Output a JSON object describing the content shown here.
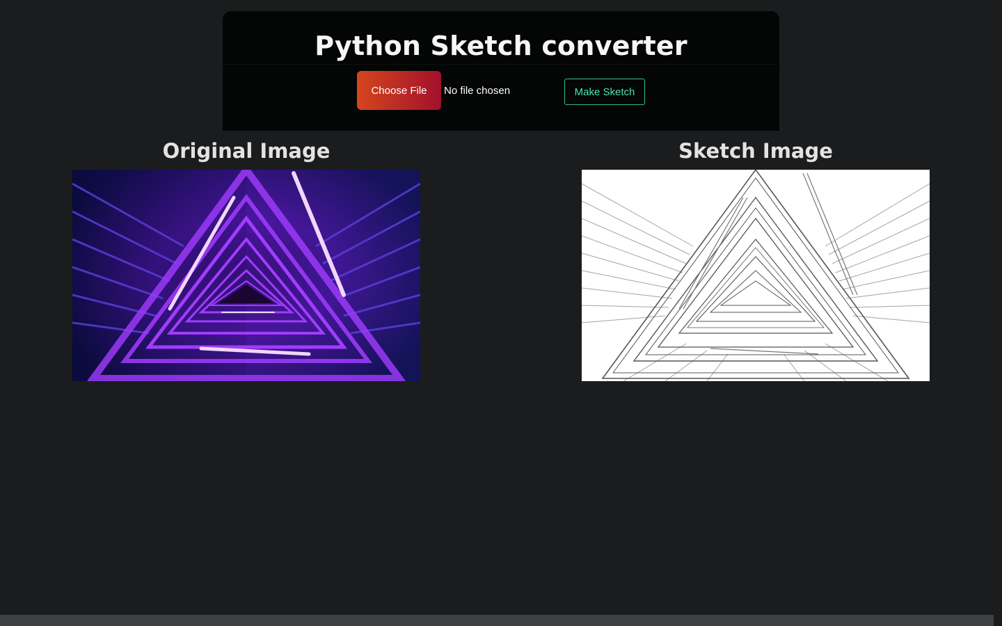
{
  "header": {
    "title": "Python Sketch converter",
    "choose_file_label": "Choose File",
    "file_status": "No file chosen",
    "make_sketch_label": "Make Sketch"
  },
  "panels": {
    "original": {
      "title": "Original Image",
      "image_description_icon": "neon-triangle-stairwell-image"
    },
    "sketch": {
      "title": "Sketch Image",
      "image_description_icon": "pencil-sketch-stairwell-image"
    }
  },
  "colors": {
    "background": "#1b1c1e",
    "header_bg": "#040505",
    "choose_file_gradient_start": "#d4461e",
    "choose_file_gradient_end": "#a3102b",
    "make_sketch_accent": "#4be3a8",
    "neon_purple": "#a13cff"
  }
}
